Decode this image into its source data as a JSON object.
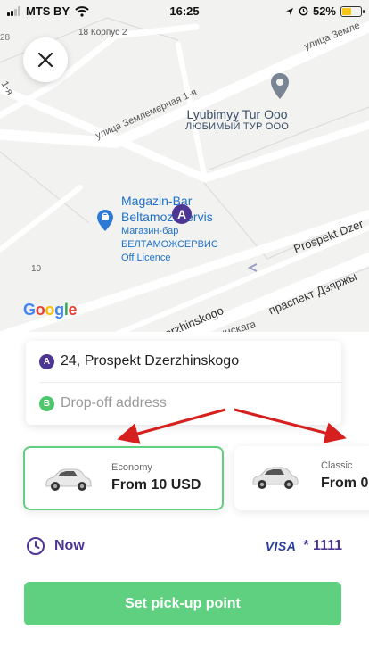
{
  "status_bar": {
    "carrier": "MTS BY",
    "time": "16:25",
    "battery": "52%",
    "battery_level": 0.52
  },
  "map": {
    "labels": {
      "korpus": "18 Корпус 2",
      "zemlemernaya": "улица Землемерная 1-я",
      "zemlem_right": "улица Земле",
      "edge_1ya": "1-я",
      "edge_28": "28",
      "dzerzhinskogo_right": "Prospekt Dzer",
      "dzerzhinskogo_left": "ект Dzerzhinskogo",
      "dzyarzh_right": "праспект Дзяржы",
      "dzyarzh_left": "ржынскага",
      "num_10": "10"
    },
    "poi_tour": {
      "name": "Lyubimyy Tur Ooo",
      "name_ru": "ЛЮБИМЫЙ ТУР ООО"
    },
    "poi_shop": {
      "line1": "Magazin-Bar",
      "line2": "Beltamozhservis",
      "line3": "Магазин-бар",
      "line4": "БЕЛТАМОЖСЕРВИС",
      "line5": "Off Licence"
    },
    "pin_letter": "A",
    "google_logo": "Google"
  },
  "addresses": {
    "from_badge": "A",
    "from": "24, Prospekt Dzerzhinskogo",
    "to_badge": "B",
    "to_placeholder": "Drop-off address"
  },
  "tariffs": [
    {
      "name": "Economy",
      "price": "From 10 USD",
      "selected": true
    },
    {
      "name": "Classic",
      "price": "From 0",
      "selected": false
    }
  ],
  "time_option": "Now",
  "payment": {
    "brand": "VISA",
    "card": "* 1111"
  },
  "cta_label": "Set pick-up point",
  "colors": {
    "brand_purple": "#4d3594",
    "accent_green": "#5fcf80",
    "arrow_red": "#d61f1f"
  }
}
